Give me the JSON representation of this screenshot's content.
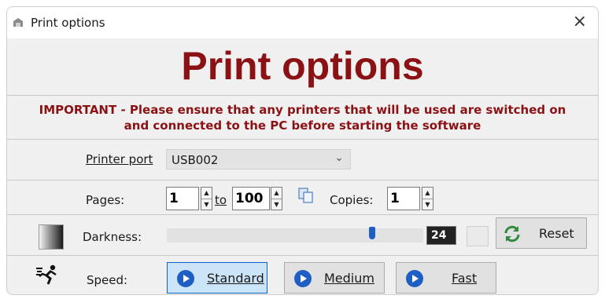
{
  "window": {
    "title": "Print options",
    "close": "×"
  },
  "heading": "Print options",
  "notice": {
    "line1": "IMPORTANT - Please ensure that any printers that will be used are switched on",
    "line2": "and connected to the PC before starting the software"
  },
  "printer": {
    "label": "Printer port",
    "value": "USB002"
  },
  "pages": {
    "label": "Pages:",
    "from": "1",
    "to_label": "to",
    "to": "100"
  },
  "copies": {
    "label": "Copies:",
    "value": "1"
  },
  "darkness": {
    "label": "Darkness:",
    "value": "24",
    "level": 0.8
  },
  "reset": {
    "label": "Reset"
  },
  "speed": {
    "label": "Speed:",
    "options": [
      "Standard",
      "Medium",
      "Fast"
    ],
    "selected": "Standard"
  },
  "colors": {
    "heading": "#8b1214",
    "accent": "#1f5fc4",
    "reset_icon": "#2e8b3d"
  }
}
